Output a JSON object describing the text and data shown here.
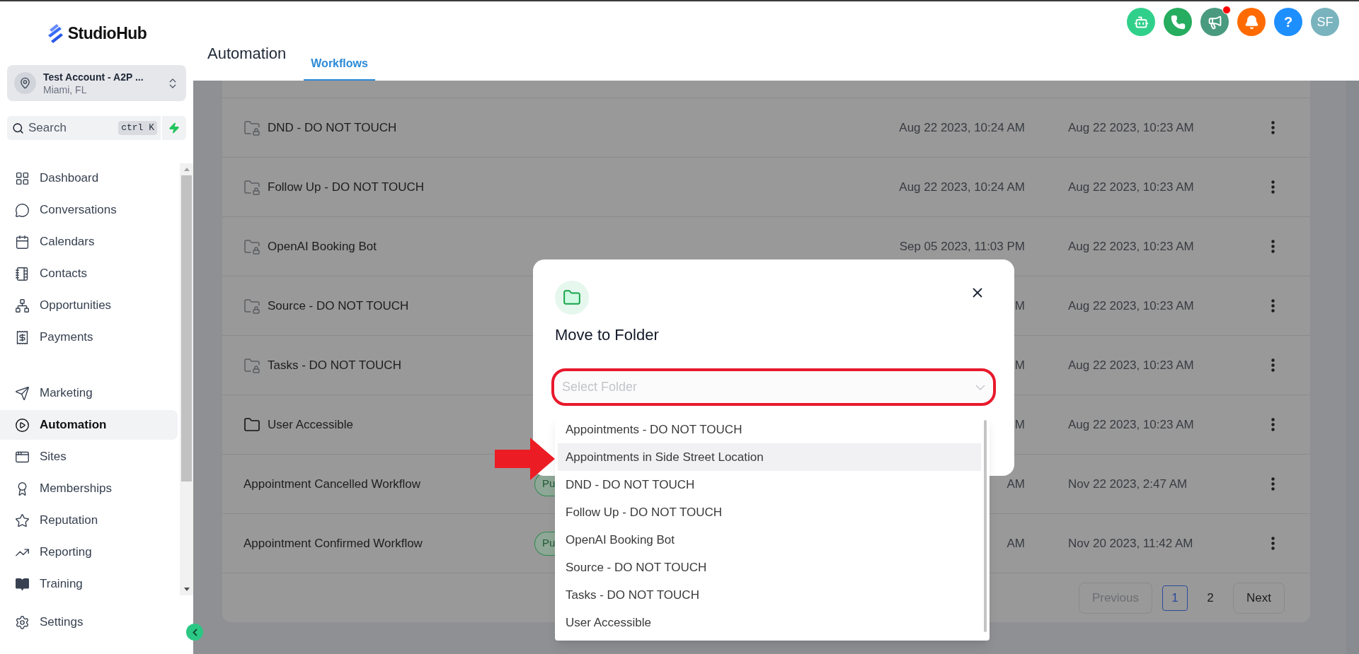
{
  "sidebar": {
    "brand": "StudioHub",
    "account": {
      "name": "Test Account - A2P ...",
      "location": "Miami, FL"
    },
    "search": {
      "placeholder": "Search",
      "shortcut": "ctrl K"
    },
    "nav_primary": [
      {
        "kind": "dashboard",
        "label": "Dashboard",
        "selected": false
      },
      {
        "kind": "conversations",
        "label": "Conversations",
        "selected": false
      },
      {
        "kind": "calendars",
        "label": "Calendars",
        "selected": false
      },
      {
        "kind": "contacts",
        "label": "Contacts",
        "selected": false
      },
      {
        "kind": "opportunities",
        "label": "Opportunities",
        "selected": false
      },
      {
        "kind": "payments",
        "label": "Payments",
        "selected": false
      }
    ],
    "nav_secondary": [
      {
        "kind": "marketing",
        "label": "Marketing",
        "selected": false
      },
      {
        "kind": "automation",
        "label": "Automation",
        "selected": true
      },
      {
        "kind": "sites",
        "label": "Sites",
        "selected": false
      },
      {
        "kind": "memberships",
        "label": "Memberships",
        "selected": false
      },
      {
        "kind": "reputation",
        "label": "Reputation",
        "selected": false
      },
      {
        "kind": "reporting",
        "label": "Reporting",
        "selected": false
      },
      {
        "kind": "training",
        "label": "Training",
        "selected": false
      }
    ],
    "settings": "Settings"
  },
  "header": {
    "title": "Automation",
    "tabs": [
      {
        "label": "Workflows",
        "selected": true
      }
    ],
    "actions": [
      {
        "kind": "robot"
      },
      {
        "kind": "phone"
      },
      {
        "kind": "megaphone",
        "dot": true
      },
      {
        "kind": "bell"
      },
      {
        "kind": "help",
        "text": "?"
      },
      {
        "kind": "avatar",
        "text": "SF"
      }
    ]
  },
  "table": {
    "rows": [
      {
        "kind": "folder",
        "locked": true,
        "name": "DND - DO NOT TOUCH",
        "updated": "Aug 22 2023, 10:24 AM",
        "created": "Aug 22 2023, 10:23 AM"
      },
      {
        "kind": "folder",
        "locked": true,
        "name": "Follow Up - DO NOT TOUCH",
        "updated": "Aug 22 2023, 10:24 AM",
        "created": "Aug 22 2023, 10:23 AM"
      },
      {
        "kind": "folder",
        "locked": true,
        "name": "OpenAI Booking Bot",
        "updated": "Sep 05 2023, 11:03 PM",
        "created": "Aug 22 2023, 10:23 AM"
      },
      {
        "kind": "folder",
        "locked": true,
        "name": "Source - DO NOT TOUCH",
        "updated": "M",
        "created": "Aug 22 2023, 10:23 AM"
      },
      {
        "kind": "folder",
        "locked": true,
        "name": "Tasks - DO NOT TOUCH",
        "updated": "M",
        "created": "Aug 22 2023, 10:23 AM"
      },
      {
        "kind": "folder",
        "locked": false,
        "name": "User Accessible",
        "updated": "M",
        "created": "Aug 22 2023, 10:23 AM"
      },
      {
        "kind": "workflow",
        "name": "Appointment Cancelled Workflow",
        "status": "Pu",
        "updated": "AM",
        "created": "Nov 22 2023, 2:47 AM"
      },
      {
        "kind": "workflow",
        "name": "Appointment Confirmed Workflow",
        "status": "Pu",
        "updated": "AM",
        "created": "Nov 20 2023, 11:42 AM"
      }
    ]
  },
  "pagination": {
    "previous": {
      "label": "Previous",
      "disabled": true
    },
    "pages": [
      {
        "label": "1",
        "selected": true
      },
      {
        "label": "2",
        "selected": false
      }
    ],
    "next": {
      "label": "Next",
      "disabled": false
    }
  },
  "modal": {
    "title": "Move to Folder",
    "select": {
      "placeholder": "Select Folder"
    },
    "options": [
      {
        "label": "Appointments - DO NOT TOUCH",
        "highlighted": false
      },
      {
        "label": "Appointments in Side Street Location",
        "highlighted": true
      },
      {
        "label": "DND - DO NOT TOUCH",
        "highlighted": false
      },
      {
        "label": "Follow Up - DO NOT TOUCH",
        "highlighted": false
      },
      {
        "label": "OpenAI Booking Bot",
        "highlighted": false
      },
      {
        "label": "Source - DO NOT TOUCH",
        "highlighted": false
      },
      {
        "label": "Tasks - DO NOT TOUCH",
        "highlighted": false
      },
      {
        "label": "User Accessible",
        "highlighted": false
      }
    ]
  }
}
